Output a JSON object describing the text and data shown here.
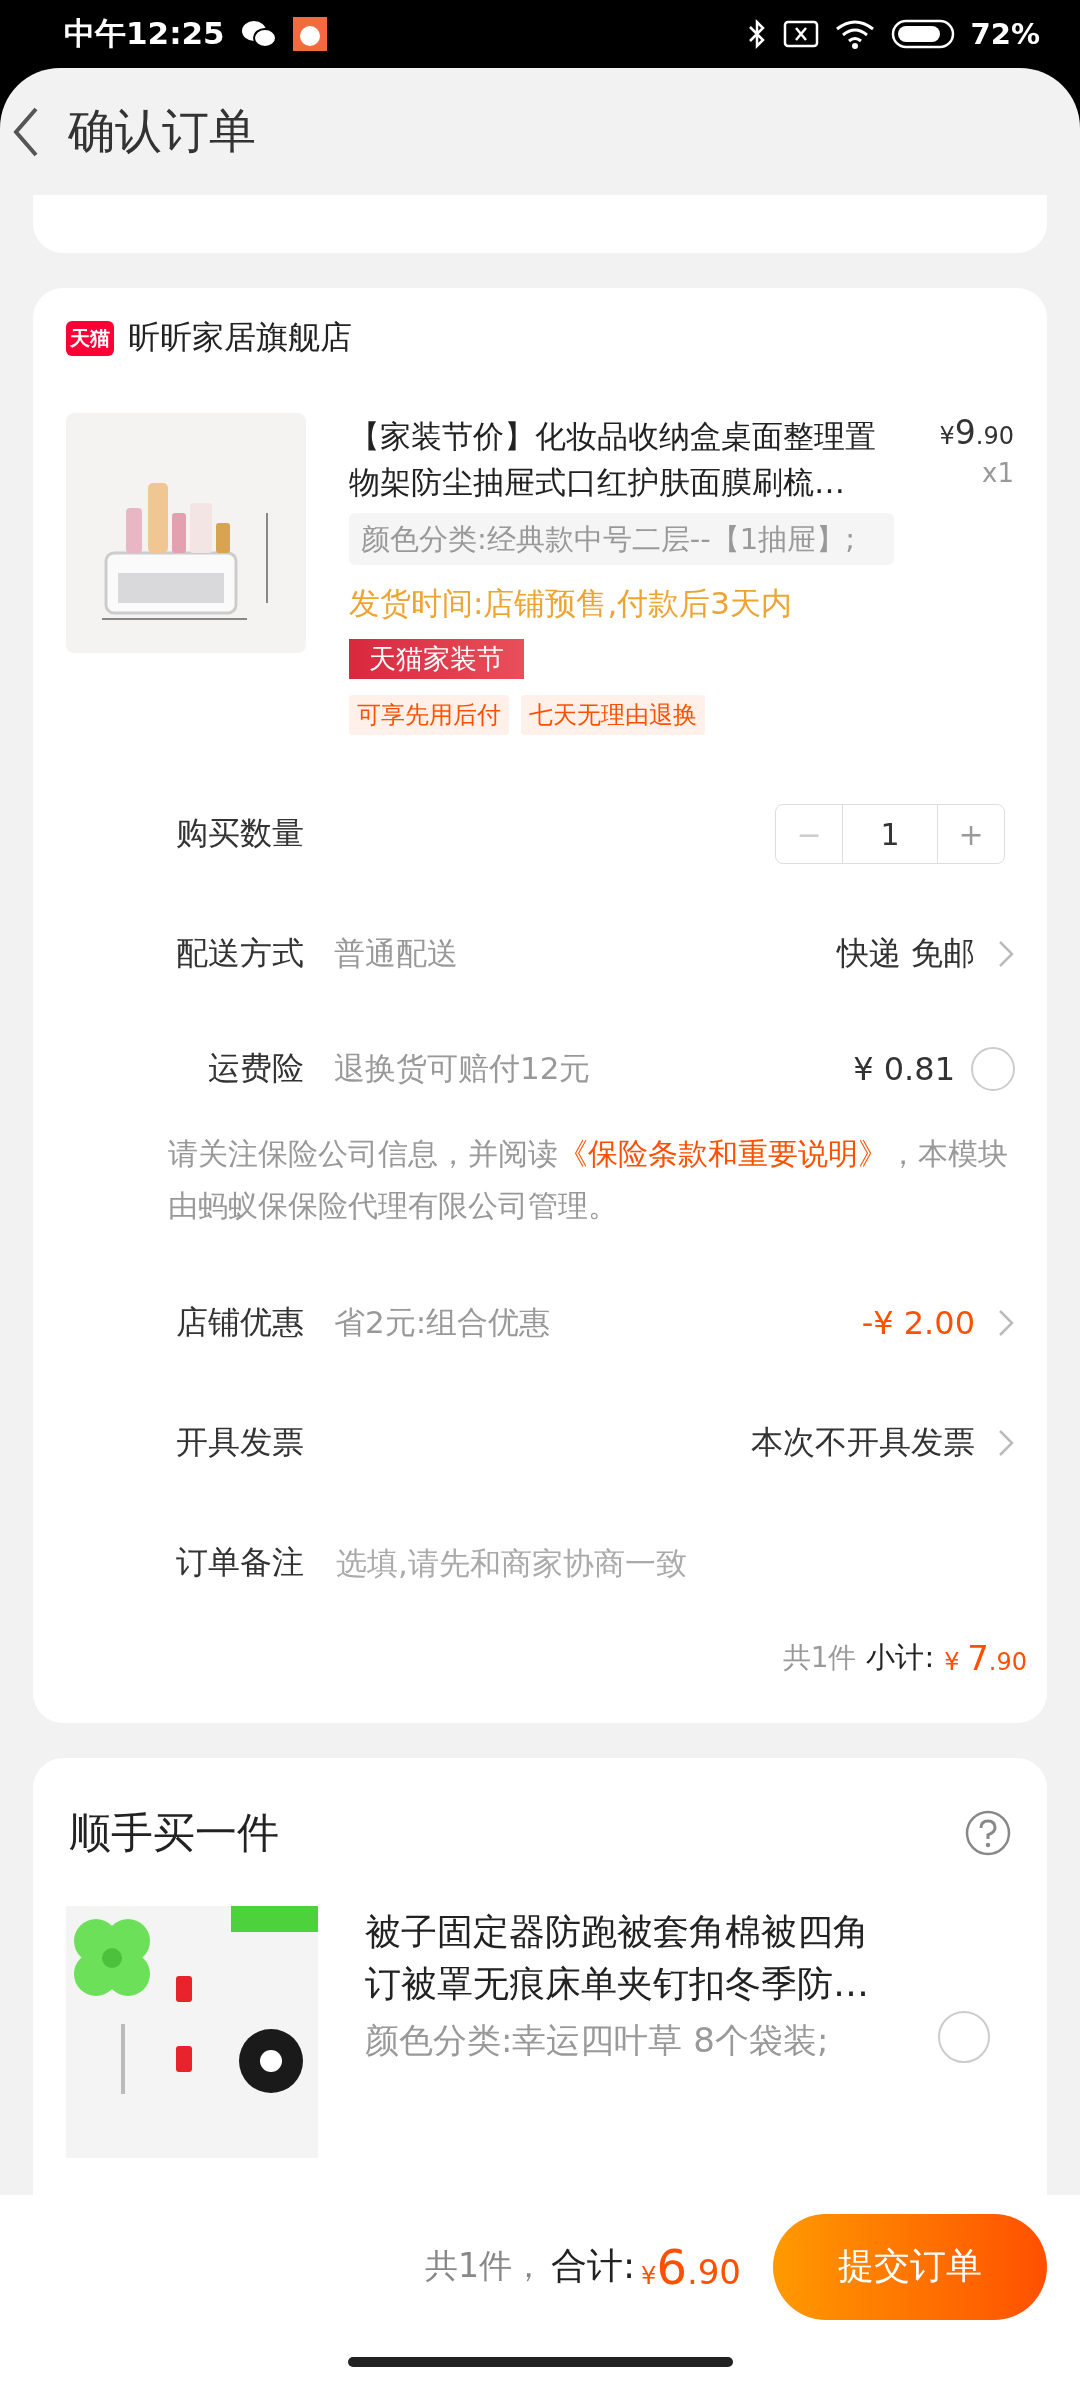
{
  "status_bar": {
    "time": "中午12:25",
    "battery": "72%"
  },
  "header": {
    "title": "确认订单"
  },
  "store": {
    "badge": "天猫",
    "name": "昕昕家居旗舰店"
  },
  "product": {
    "title": "【家装节价】化妆品收纳盒桌面整理置物架防尘抽屉式口红护肤面膜刷梳…",
    "currency": "¥",
    "price_integer": "9",
    "price_decimal": ".90",
    "quantity": "x1",
    "spec": "颜色分类:经典款中号二层--【1抽屉】;",
    "shipping": "发货时间:店铺预售,付款后3天内",
    "promo_tag": "天猫家装节",
    "service_tags": [
      "可享先用后付",
      "七天无理由退换"
    ]
  },
  "rows": [
    {
      "kind": "stepper",
      "label": "购买数量",
      "minus": "−",
      "value": "1",
      "plus": "+",
      "minus_disabled": true
    },
    {
      "kind": "link",
      "label": "配送方式",
      "hint": "普通配送",
      "value": "快递 免邮",
      "highlight": false
    },
    {
      "kind": "radio",
      "label": "运费险",
      "hint": "退换货可赔付12元",
      "value": "¥ 0.81",
      "checked": false
    },
    {
      "kind": "notice",
      "before": "请关注保险公司信息，并阅读",
      "link": "《保险条款和重要说明》",
      "after": "，本模块由蚂蚁保保险代理有限公司管理。"
    },
    {
      "kind": "link",
      "label": "店铺优惠",
      "hint": "省2元:组合优惠",
      "value": "-¥ 2.00",
      "highlight": true
    },
    {
      "kind": "link",
      "label": "开具发票",
      "value": "本次不开具发票",
      "highlight": false
    },
    {
      "kind": "input",
      "label": "订单备注",
      "placeholder": "选填,请先和商家协商一致"
    }
  ],
  "subtotal": {
    "count": "共1件",
    "label": "小计:",
    "currency": "¥",
    "integer": "7",
    "decimal": ".90"
  },
  "addon": {
    "title": "顺手买一件",
    "item": {
      "title": "被子固定器防跑被套角棉被四角订被罩无痕床单夹钉扣冬季防…",
      "spec": "颜色分类:幸运四叶草 8个袋装;",
      "selected": false
    }
  },
  "footer": {
    "count": "共1件，",
    "label": "合计:",
    "currency": "¥",
    "integer": "6",
    "decimal": ".90",
    "submit": "提交订单"
  }
}
